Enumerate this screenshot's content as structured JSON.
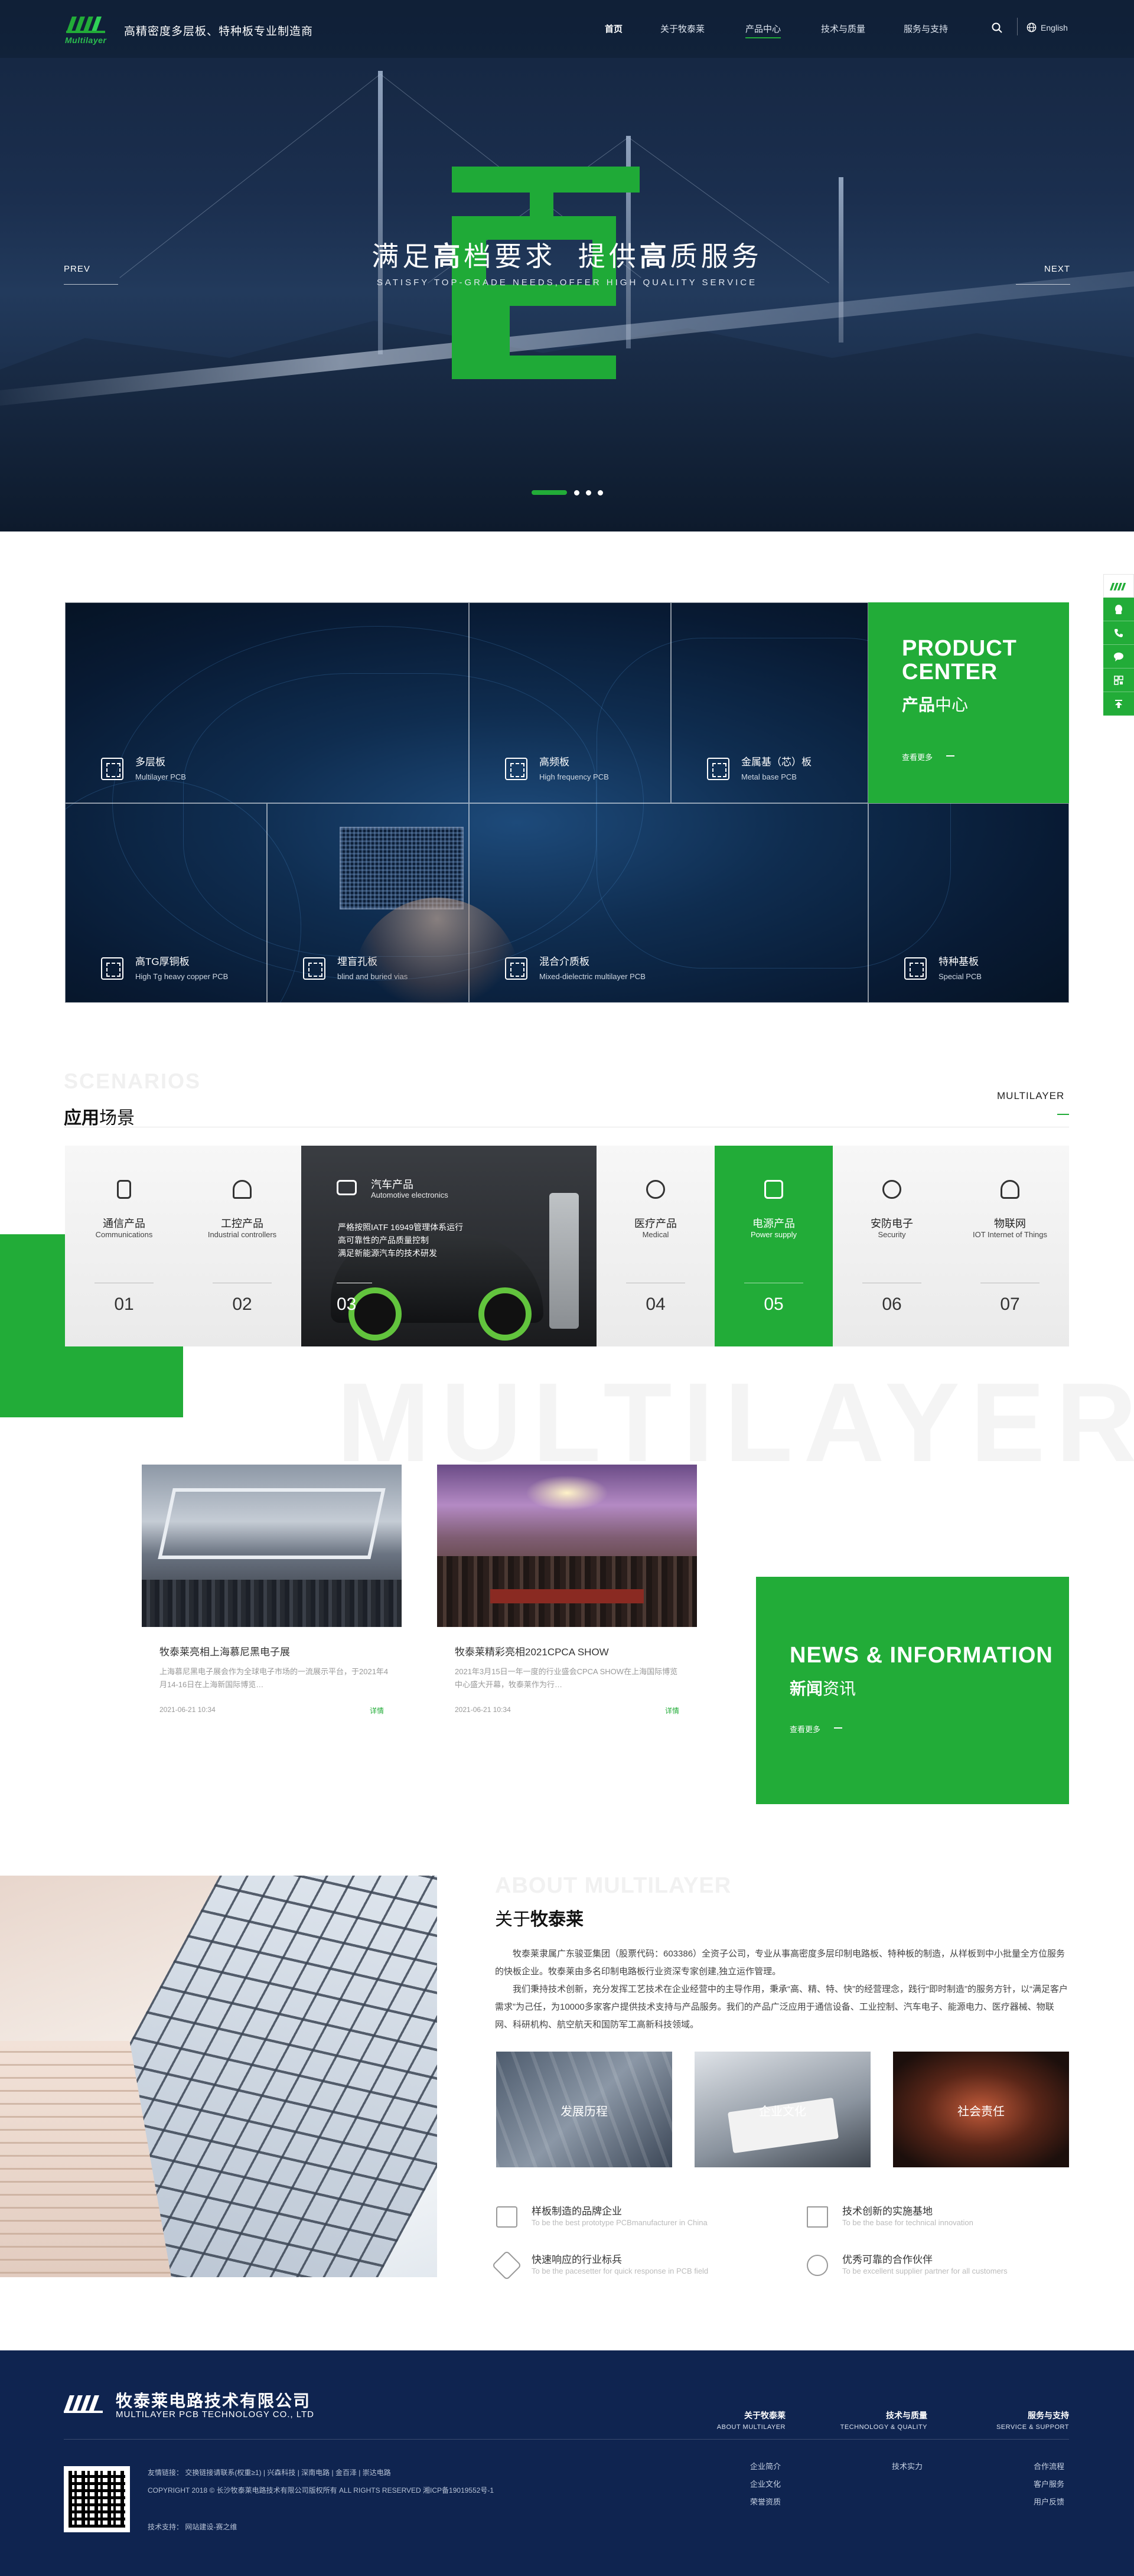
{
  "header": {
    "logo_text": "Multilayer",
    "slogan": "高精密度多层板、特种板专业制造商",
    "menu": [
      "首页",
      "关于牧泰莱",
      "产品中心",
      "技术与质量",
      "服务与支持"
    ],
    "lang": "English",
    "icons": [
      "search-icon",
      "globe-icon"
    ]
  },
  "hero": {
    "title_parts": [
      "满足",
      "高",
      "档要求",
      "提供",
      "高",
      "质服务"
    ],
    "subtitle": "SATISFY TOP-GRADE NEEDS,OFFER HIGH QUALITY SERVICE",
    "prev": "PREV",
    "next": "NEXT",
    "slide_count": 4,
    "active_slide": 1
  },
  "sidebar": {
    "items": [
      "multilayer-logo-icon",
      "qq-icon",
      "phone-icon",
      "chat-icon",
      "qrcode-icon",
      "back-to-top-icon"
    ]
  },
  "products": {
    "panel_en": "PRODUCT CENTER",
    "panel_cn_bold": "产品",
    "panel_cn_rest": "中心",
    "more": "查看更多",
    "items": [
      {
        "cn": "多层板",
        "en": "Multilayer PCB"
      },
      {
        "cn": "高频板",
        "en": "High frequency PCB"
      },
      {
        "cn": "金属基（芯）板",
        "en": "Metal base PCB"
      },
      {
        "cn": "高TG厚铜板",
        "en": "High Tg heavy copper PCB"
      },
      {
        "cn": "埋盲孔板",
        "en": "blind and buried vias"
      },
      {
        "cn": "混合介质板",
        "en": "Mixed-dielectric multilayer PCB"
      },
      {
        "cn": "特种基板",
        "en": "Special PCB"
      }
    ]
  },
  "scenarios": {
    "bg_text": "SCENARIOS",
    "title_bold": "应用",
    "title_rest": "场景",
    "right_label": "MULTILAYER",
    "items": [
      {
        "cn": "通信产品",
        "en": "Communications",
        "num": "01"
      },
      {
        "cn": "工控产品",
        "en": "Industrial controllers",
        "num": "02"
      },
      {
        "cn": "汽车产品",
        "en": "Automotive electronics",
        "num": "03"
      },
      {
        "cn": "医疗产品",
        "en": "Medical",
        "num": "04"
      },
      {
        "cn": "电源产品",
        "en": "Power supply",
        "num": "05"
      },
      {
        "cn": "安防电子",
        "en": "Security",
        "num": "06"
      },
      {
        "cn": "物联网",
        "en": "IOT Internet of Things",
        "num": "07"
      }
    ],
    "auto_features": [
      "严格按照IATF 16949管理体系运行",
      "高可靠性的产品质量控制",
      "满足新能源汽车的技术研发"
    ]
  },
  "news": {
    "bg_text": "MULTILAYER",
    "panel_en": "NEWS & INFORMATION",
    "panel_cn_bold": "新闻",
    "panel_cn_rest": "资讯",
    "more": "查看更多",
    "items": [
      {
        "title": "牧泰莱亮相上海慕尼黑电子展",
        "desc": "上海慕尼黑电子展会作为全球电子市场的一流展示平台，于2021年4月14-16日在上海新国际博览…",
        "date": "2021-06-21  10:34",
        "more": "详情"
      },
      {
        "title": "牧泰莱精彩亮相2021CPCA SHOW",
        "desc": "2021年3月15日一年一度的行业盛会CPCA SHOW在上海国际博览中心盛大开幕，牧泰莱作为行…",
        "date": "2021-06-21  10:34",
        "more": "详情"
      }
    ]
  },
  "about": {
    "bg_text": "ABOUT MULTILAYER",
    "title_rest": "关于",
    "title_bold": "牧泰莱",
    "paragraphs": [
      "牧泰莱隶属广东骏亚集团（股票代码：603386）全资子公司，专业从事高密度多层印制电路板、特种板的制造，从样板到中小批量全方位服务的快板企业。牧泰莱由多名印制电路板行业资深专家创建,独立运作管理。",
      "我们秉持技术创新，充分发挥工艺技术在企业经营中的主导作用，秉承“高、精、特、快”的经营理念，践行“即时制造”的服务方针，以“满足客户需求”为己任，为10000多家客户提供技术支持与产品服务。我们的产品广泛应用于通信设备、工业控制、汽车电子、能源电力、医疗器械、物联网、科研机构、航空航天和国防军工高新科技领域。"
    ],
    "pics": [
      "发展历程",
      "企业文化",
      "社会责任"
    ],
    "advantages": [
      {
        "cn": "样板制造的品牌企业",
        "en": "To be the best prototype PCBmanufacturer in China"
      },
      {
        "cn": "技术创新的实施基地",
        "en": "To be the base for technical innovation"
      },
      {
        "cn": "快速响应的行业标兵",
        "en": "To be the pacesetter for quick response in PCB field"
      },
      {
        "cn": "优秀可靠的合作伙伴",
        "en": "To be excellent supplier partner for all customers"
      }
    ]
  },
  "footer": {
    "company_cn": "牧泰莱电路技术有限公司",
    "company_en": "MULTILAYER PCB TECHNOLOGY CO., LTD",
    "links_line": "友情链接：  交换链接请联系(权重≥1)  |  兴森科技  |  深南电路  |  金百泽  |  崇达电路",
    "copyright": "COPYRIGHT 2018 © 长沙牧泰莱电路技术有限公司版权所有    ALL RIGHTS RESERVED  湘ICP备19019552号-1",
    "tech": "技术支持：  网站建设-赛之维",
    "cols": [
      {
        "cn": "关于牧泰莱",
        "en": "ABOUT MULTILAYER",
        "links": [
          "企业简介",
          "企业文化",
          "荣誉资质"
        ]
      },
      {
        "cn": "技术与质量",
        "en": "TECHNOLOGY & QUALITY",
        "links": [
          "技术实力"
        ]
      },
      {
        "cn": "服务与支持",
        "en": "SERVICE & SUPPORT",
        "links": [
          "合作流程",
          "客户服务",
          "用户反馈"
        ]
      }
    ]
  },
  "colors": {
    "brand_green": "#22ac38",
    "footer_navy": "#0f2450"
  }
}
